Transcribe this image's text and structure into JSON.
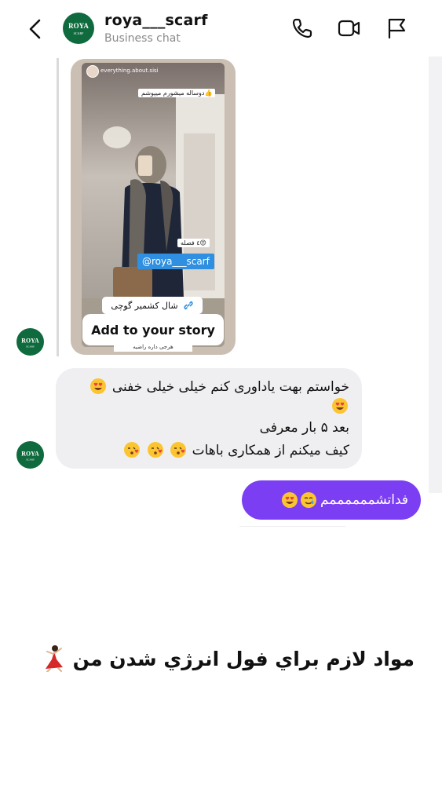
{
  "header": {
    "title": "roya___scarf",
    "subtitle": "Business chat",
    "avatar_text_top": "ROYA",
    "avatar_text_bottom": "SCARF",
    "icons": [
      "back-chevron-icon",
      "phone-icon",
      "video-camera-icon",
      "flag-icon"
    ]
  },
  "story": {
    "username": "everything.about.sisi",
    "note_top": "دوساله میشورم میپوشم",
    "note_pieces": "٤ فصله",
    "mention": "@roya___scarf",
    "link_text": "شال کشمیر گوچی",
    "add_button": "Add to your story",
    "bottom_note": "هرجی داره راضیه"
  },
  "incoming_message": {
    "line1": "خواستم بهت یاداوری کنم خیلی خیلی خفنی",
    "line3": "بعد ۵ بار معرفی",
    "line4": "کیف میکنم از همکاری باهات"
  },
  "outgoing_message": {
    "text": "فداتشممممممم"
  },
  "caption": {
    "text": "مواد لازم براي فول انرژي شدن من"
  },
  "colors": {
    "brand_green": "#0f6b3e",
    "outgoing_bubble": "#7c3ef2",
    "incoming_bubble": "#efeff2"
  }
}
